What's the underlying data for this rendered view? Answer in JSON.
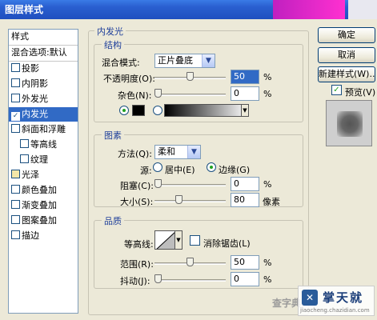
{
  "window": {
    "title": "图层样式"
  },
  "style_list": {
    "header": "样式",
    "items": [
      {
        "label": "混合选项:默认",
        "checkbox": false,
        "checked": false,
        "selected": false,
        "indent": 0
      },
      {
        "label": "投影",
        "checkbox": true,
        "checked": false,
        "selected": false,
        "indent": 0
      },
      {
        "label": "内阴影",
        "checkbox": true,
        "checked": false,
        "selected": false,
        "indent": 0
      },
      {
        "label": "外发光",
        "checkbox": true,
        "checked": false,
        "selected": false,
        "indent": 0
      },
      {
        "label": "内发光",
        "checkbox": true,
        "checked": true,
        "selected": true,
        "indent": 0
      },
      {
        "label": "斜面和浮雕",
        "checkbox": true,
        "checked": false,
        "selected": false,
        "indent": 0
      },
      {
        "label": "等高线",
        "checkbox": true,
        "checked": false,
        "selected": false,
        "indent": 1
      },
      {
        "label": "纹理",
        "checkbox": true,
        "checked": false,
        "selected": false,
        "indent": 1
      },
      {
        "label": "光泽",
        "checkbox": true,
        "checked": false,
        "selected": false,
        "indent": 0
      },
      {
        "label": "颜色叠加",
        "checkbox": true,
        "checked": false,
        "selected": false,
        "indent": 0
      },
      {
        "label": "渐变叠加",
        "checkbox": true,
        "checked": false,
        "selected": false,
        "indent": 0
      },
      {
        "label": "图案叠加",
        "checkbox": true,
        "checked": false,
        "selected": false,
        "indent": 0
      },
      {
        "label": "描边",
        "checkbox": true,
        "checked": false,
        "selected": false,
        "indent": 0
      }
    ]
  },
  "inner_glow": {
    "title": "内发光",
    "structure": {
      "title": "结构",
      "blend_mode_label": "混合模式:",
      "blend_mode_value": "正片叠底",
      "opacity_label": "不透明度(O):",
      "opacity_value": "50",
      "opacity_unit": "%",
      "opacity_fraction": 0.5,
      "noise_label": "杂色(N):",
      "noise_value": "0",
      "noise_unit": "%",
      "noise_fraction": 0.0,
      "color_mode": "solid",
      "glow_color": "#000000"
    },
    "elements": {
      "title": "图素",
      "technique_label": "方法(Q):",
      "technique_value": "柔和",
      "source_label": "源:",
      "source_center_label": "居中(E)",
      "source_edge_label": "边缘(G)",
      "source_selected": "edge",
      "choke_label": "阻塞(C):",
      "choke_value": "0",
      "choke_unit": "%",
      "choke_fraction": 0.0,
      "size_label": "大小(S):",
      "size_value": "80",
      "size_unit": "像素",
      "size_fraction": 0.32
    },
    "quality": {
      "title": "品质",
      "contour_label": "等高线:",
      "antialias_label": "消除锯齿(L)",
      "antialias_checked": false,
      "range_label": "范围(R):",
      "range_value": "50",
      "range_unit": "%",
      "range_fraction": 0.5,
      "jitter_label": "抖动(J):",
      "jitter_value": "0",
      "jitter_unit": "%",
      "jitter_fraction": 0.0
    }
  },
  "buttons": {
    "ok": "确定",
    "cancel": "取消",
    "new_style": "新建样式(W)...",
    "preview_label": "预览(V)",
    "preview_checked": true
  },
  "watermark": {
    "left_text": "查字典",
    "logo_text": "掌天就",
    "url": "jiaocheng.chazidian.com"
  },
  "colors": {
    "selection": "#316ac5",
    "titlebar": "#2a5fd0",
    "legend_text": "#1e3f9a",
    "dialog_bg": "#ece9d8"
  }
}
